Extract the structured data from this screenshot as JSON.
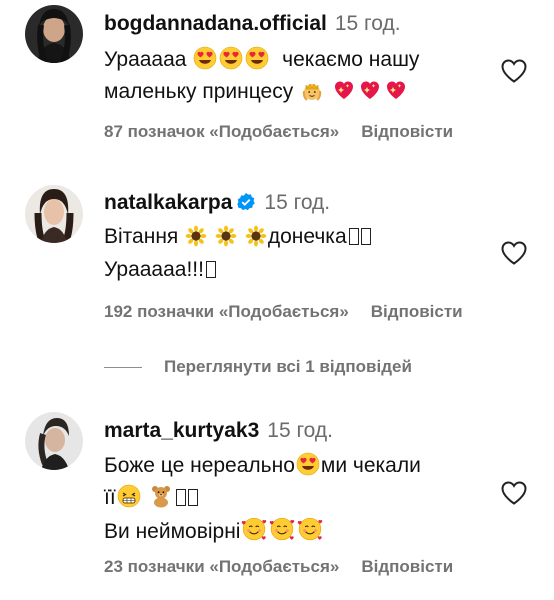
{
  "comments": [
    {
      "username": "bogdannadana.official",
      "time": "15 год.",
      "verified": false,
      "line1_text_a": "Урааааа",
      "line1_text_b": "чекаємо нашу",
      "line2_text": "маленьку принцесу",
      "likes": "87 позначок «Подобається»",
      "reply": "Відповісти",
      "emoji_line1": [
        "heart-eyes",
        "heart-eyes",
        "heart-eyes"
      ],
      "emoji_line2": [
        "princess",
        "sparkling-heart",
        "sparkling-heart",
        "sparkling-heart"
      ]
    },
    {
      "username": "natalkakarpa",
      "time": "15 год.",
      "verified": true,
      "line1_text_a": "Вітання",
      "line1_text_b": "донечка",
      "line2_text": "Урааааа!!!",
      "likes": "192 позначки «Подобається»",
      "reply": "Відповісти",
      "emoji_line1": [
        "sunflower",
        "sunflower",
        "sunflower"
      ],
      "view_replies": "Переглянути всі 1 відповідей"
    },
    {
      "username": "marta_kurtyak3",
      "time": "15 год.",
      "verified": false,
      "line1_text_a": "Боже це нереально",
      "line1_text_b": "ми чекали",
      "line2_text": "її",
      "line3_text": "Ви неймовірні",
      "likes": "23 позначки «Подобається»",
      "reply": "Відповісти",
      "emoji_line1": [
        "heart-eyes"
      ],
      "emoji_line2": [
        "grin",
        "teddy-bear"
      ],
      "emoji_line3": [
        "smiling-hearts",
        "smiling-hearts",
        "smiling-hearts"
      ]
    }
  ],
  "colors": {
    "text": "#111111",
    "muted": "#737373",
    "verified_blue": "#0095f6"
  },
  "icons": [
    "heart-outline-icon",
    "verified-badge-icon"
  ]
}
